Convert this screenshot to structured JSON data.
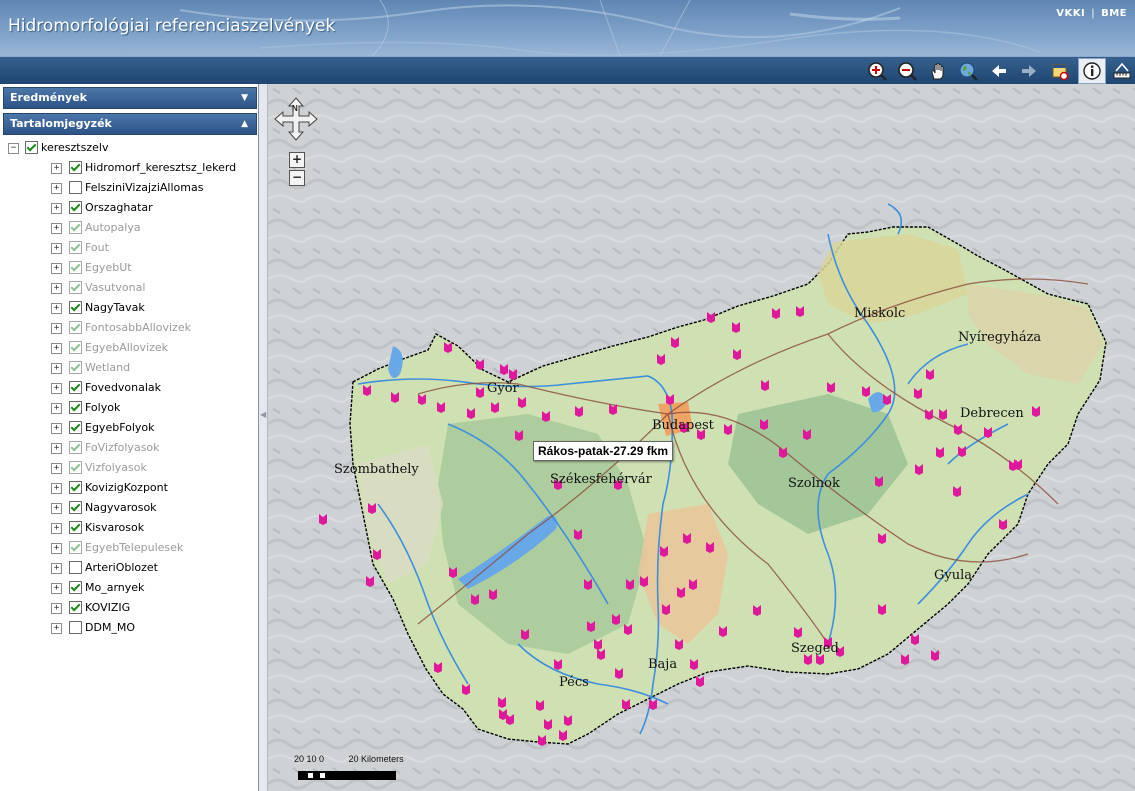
{
  "header": {
    "title": "Hidromorfológiai referenciaszelvények",
    "links": [
      "VKKI",
      "BME"
    ]
  },
  "toolbar": {
    "tools": [
      {
        "name": "zoom-in-icon"
      },
      {
        "name": "zoom-out-icon"
      },
      {
        "name": "pan-hand-icon"
      },
      {
        "name": "full-extent-globe-icon"
      },
      {
        "name": "back-arrow-icon"
      },
      {
        "name": "forward-arrow-icon"
      },
      {
        "name": "select-area-icon"
      },
      {
        "name": "identify-info-icon",
        "active": true
      },
      {
        "name": "measure-icon"
      }
    ]
  },
  "sidebar": {
    "results_panel": {
      "label": "Eredmények",
      "expanded": false
    },
    "toc_panel": {
      "label": "Tartalomjegyzék",
      "expanded": true
    },
    "root": {
      "label": "keresztszelv",
      "checked": true
    },
    "layers": [
      {
        "label": "Hidromorf_keresztsz_lekerd",
        "checked": true,
        "enabled": true
      },
      {
        "label": "FelsziniVizajziAllomas",
        "checked": false,
        "enabled": true
      },
      {
        "label": "Orszaghatar",
        "checked": true,
        "enabled": true
      },
      {
        "label": "Autopalya",
        "checked": true,
        "enabled": false
      },
      {
        "label": "Fout",
        "checked": true,
        "enabled": false
      },
      {
        "label": "EgyebUt",
        "checked": true,
        "enabled": false
      },
      {
        "label": "Vasutvonal",
        "checked": true,
        "enabled": false
      },
      {
        "label": "NagyTavak",
        "checked": true,
        "enabled": true
      },
      {
        "label": "FontosabbAllovizek",
        "checked": true,
        "enabled": false
      },
      {
        "label": "EgyebAllovizek",
        "checked": true,
        "enabled": false
      },
      {
        "label": "Wetland",
        "checked": true,
        "enabled": false
      },
      {
        "label": "Fovedvonalak",
        "checked": true,
        "enabled": true
      },
      {
        "label": "Folyok",
        "checked": true,
        "enabled": true
      },
      {
        "label": "EgyebFolyok",
        "checked": true,
        "enabled": true
      },
      {
        "label": "FoVizfolyasok",
        "checked": true,
        "enabled": false
      },
      {
        "label": "Vizfolyasok",
        "checked": true,
        "enabled": false
      },
      {
        "label": "KovizigKozpont",
        "checked": true,
        "enabled": true
      },
      {
        "label": "Nagyvarosok",
        "checked": true,
        "enabled": true
      },
      {
        "label": "Kisvarosok",
        "checked": true,
        "enabled": true
      },
      {
        "label": "EgyebTelepulesek",
        "checked": true,
        "enabled": false
      },
      {
        "label": "ArteriOblozet",
        "checked": false,
        "enabled": true
      },
      {
        "label": "Mo_arnyek",
        "checked": true,
        "enabled": true
      },
      {
        "label": "KOVIZIG",
        "checked": true,
        "enabled": true
      },
      {
        "label": "DDM_MO",
        "checked": false,
        "enabled": true
      }
    ]
  },
  "map": {
    "cities": [
      "Győr",
      "Budapest",
      "Miskolc",
      "Nyíregyháza",
      "Debrecen",
      "Szombathely",
      "Székesfehérvár",
      "Szolnok",
      "Gyula",
      "Szeged",
      "Baja",
      "Pécs"
    ],
    "tooltip": "Rákos-patak-27.29 fkm",
    "zoom_in_label": "+",
    "zoom_out_label": "−",
    "scalebar": {
      "ticks": "20 10  0",
      "end_label": "20 Kilometers"
    },
    "marker_color": "#e0189b",
    "river_color": "#3f8fdd",
    "border_color": "#000000"
  }
}
